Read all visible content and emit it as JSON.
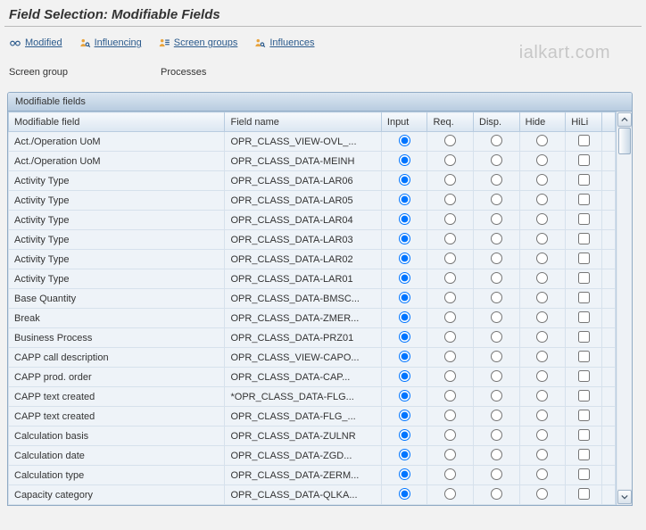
{
  "title": "Field Selection: Modifiable Fields",
  "toolbar": {
    "modified": "Modified",
    "influencing": "Influencing",
    "screen_groups": "Screen groups",
    "influences": "Influences"
  },
  "screen_group": {
    "label": "Screen group",
    "value": "Processes"
  },
  "panel": {
    "title": "Modifiable fields"
  },
  "table": {
    "headers": {
      "field": "Modifiable field",
      "name": "Field name",
      "input": "Input",
      "req": "Req.",
      "disp": "Disp.",
      "hide": "Hide",
      "hili": "HiLi"
    },
    "rows": [
      {
        "field": "Act./Operation UoM",
        "name": "OPR_CLASS_VIEW-OVL_...",
        "sel": "input",
        "hili": false
      },
      {
        "field": "Act./Operation UoM",
        "name": "OPR_CLASS_DATA-MEINH",
        "sel": "input",
        "hili": false
      },
      {
        "field": "Activity Type",
        "name": "OPR_CLASS_DATA-LAR06",
        "sel": "input",
        "hili": false
      },
      {
        "field": "Activity Type",
        "name": "OPR_CLASS_DATA-LAR05",
        "sel": "input",
        "hili": false
      },
      {
        "field": "Activity Type",
        "name": "OPR_CLASS_DATA-LAR04",
        "sel": "input",
        "hili": false
      },
      {
        "field": "Activity Type",
        "name": "OPR_CLASS_DATA-LAR03",
        "sel": "input",
        "hili": false
      },
      {
        "field": "Activity Type",
        "name": "OPR_CLASS_DATA-LAR02",
        "sel": "input",
        "hili": false
      },
      {
        "field": "Activity Type",
        "name": "OPR_CLASS_DATA-LAR01",
        "sel": "input",
        "hili": false
      },
      {
        "field": "Base Quantity",
        "name": "OPR_CLASS_DATA-BMSC...",
        "sel": "input",
        "hili": false
      },
      {
        "field": "Break",
        "name": "OPR_CLASS_DATA-ZMER...",
        "sel": "input",
        "hili": false
      },
      {
        "field": "Business Process",
        "name": "OPR_CLASS_DATA-PRZ01",
        "sel": "input",
        "hili": false
      },
      {
        "field": "CAPP call description",
        "name": "OPR_CLASS_VIEW-CAPO...",
        "sel": "input",
        "hili": false
      },
      {
        "field": "CAPP prod. order",
        "name": "OPR_CLASS_DATA-CAP...",
        "sel": "input",
        "hili": false
      },
      {
        "field": "CAPP text created",
        "name": "*OPR_CLASS_DATA-FLG...",
        "sel": "input",
        "hili": false
      },
      {
        "field": "CAPP text created",
        "name": "OPR_CLASS_DATA-FLG_...",
        "sel": "input",
        "hili": false
      },
      {
        "field": "Calculation basis",
        "name": "OPR_CLASS_DATA-ZULNR",
        "sel": "input",
        "hili": false
      },
      {
        "field": "Calculation date",
        "name": "OPR_CLASS_DATA-ZGD...",
        "sel": "input",
        "hili": false
      },
      {
        "field": "Calculation type",
        "name": "OPR_CLASS_DATA-ZERM...",
        "sel": "input",
        "hili": false
      },
      {
        "field": "Capacity category",
        "name": "OPR_CLASS_DATA-QLKA...",
        "sel": "input",
        "hili": false
      }
    ]
  },
  "watermark": "ialkart.com"
}
